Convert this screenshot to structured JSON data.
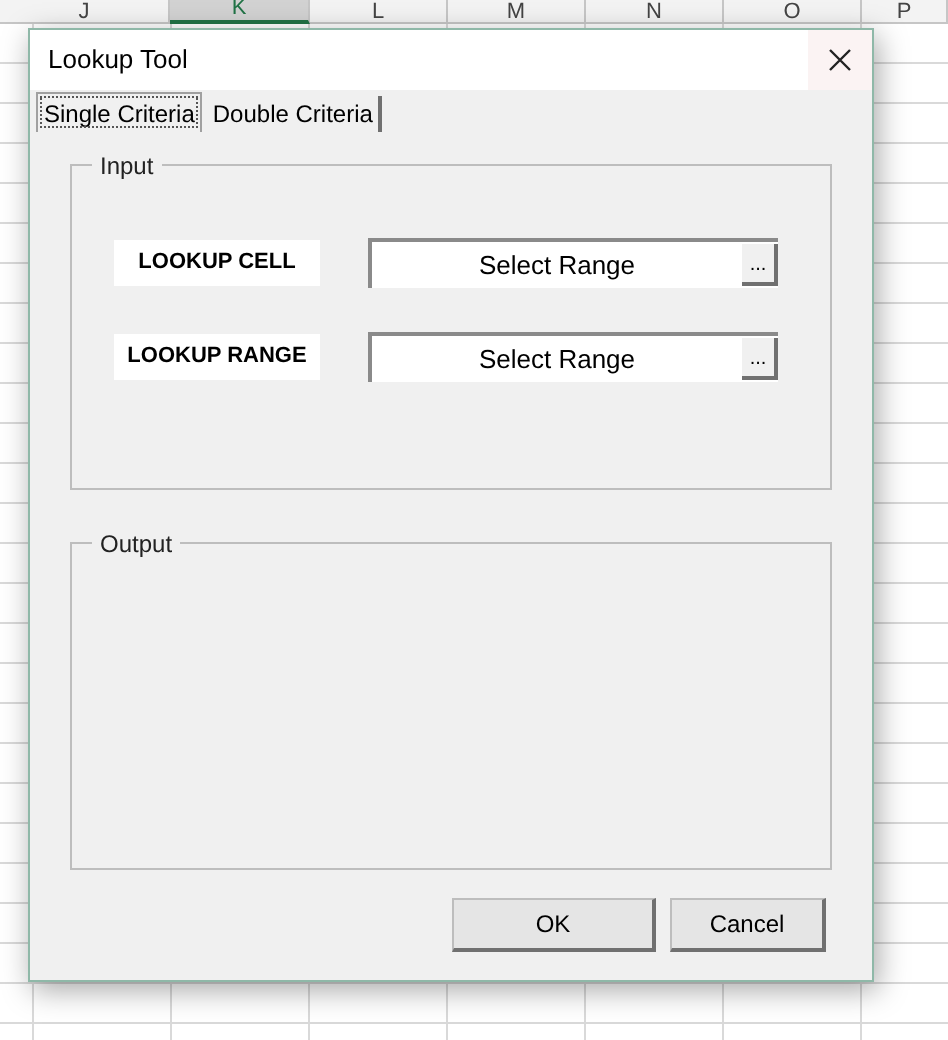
{
  "spreadsheet": {
    "columns": [
      {
        "label": "J",
        "selected": false
      },
      {
        "label": "K",
        "selected": true
      },
      {
        "label": "L",
        "selected": false
      },
      {
        "label": "M",
        "selected": false
      },
      {
        "label": "N",
        "selected": false
      },
      {
        "label": "O",
        "selected": false
      },
      {
        "label": "P",
        "selected": false
      }
    ]
  },
  "dialog": {
    "title": "Lookup Tool",
    "tabs": [
      {
        "label": "Single Criteria",
        "selected": true
      },
      {
        "label": "Double Criteria",
        "selected": false
      }
    ],
    "input_frame": {
      "title": "Input",
      "rows": [
        {
          "label": "LOOKUP CELL",
          "value": "Select Range",
          "button": "..."
        },
        {
          "label": "LOOKUP RANGE",
          "value": "Select Range",
          "button": "..."
        }
      ]
    },
    "output_frame": {
      "title": "Output"
    },
    "buttons": [
      "OK",
      "Cancel"
    ]
  }
}
